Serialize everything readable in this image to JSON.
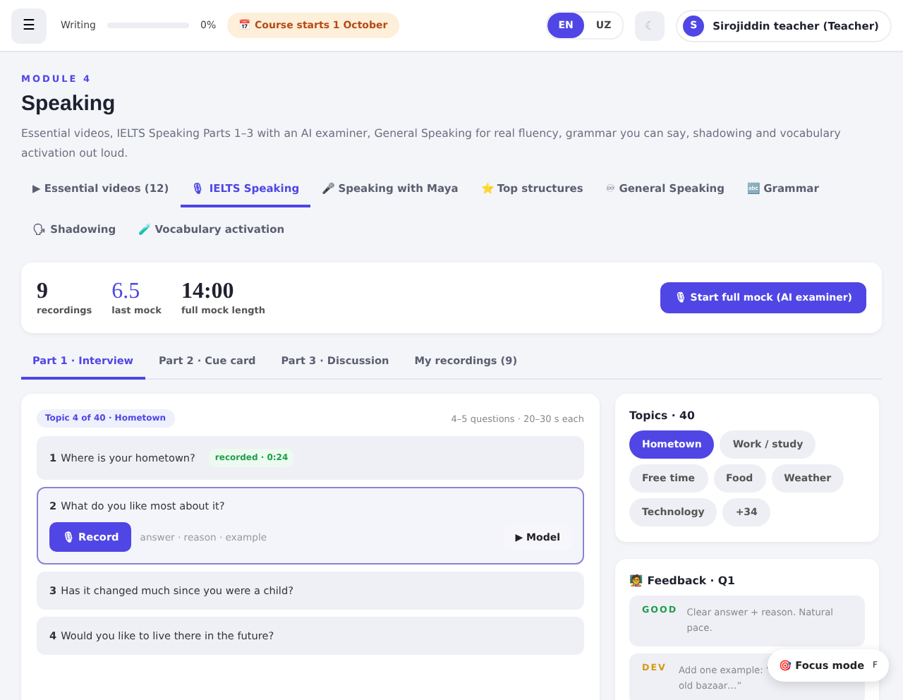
{
  "topbar": {
    "menu_icon": "☰",
    "progress": {
      "label": "Writing",
      "level": 0,
      "reading": "0%"
    },
    "notice": "📅 Course starts 1 October",
    "languages": [
      {
        "label": "EN",
        "selected": true
      },
      {
        "label": "UZ",
        "selected": false
      }
    ],
    "theme_icon": "☾",
    "user": {
      "initial": "S",
      "name": "Sirojiddin teacher (Teacher)"
    }
  },
  "module": {
    "eyebrow": "MODULE 4",
    "title": "Speaking",
    "description": "Essential videos, IELTS Speaking Parts 1–3 with an AI examiner, General Speaking for real fluency, grammar you can say, shadowing and vocabulary activation out loud."
  },
  "tabs": [
    {
      "label": "▶ Essential videos (12)",
      "selected": false
    },
    {
      "label": "🎙 IELTS Speaking",
      "selected": true
    },
    {
      "label": "🎤 Speaking with Maya",
      "selected": false
    },
    {
      "label": "⭐ Top structures",
      "selected": false
    },
    {
      "label": "♾ General Speaking",
      "selected": false
    },
    {
      "label": "🔤 Grammar",
      "selected": false
    },
    {
      "label": "🗣 Shadowing",
      "selected": false
    },
    {
      "label": "🧪 Vocabulary activation",
      "selected": false
    }
  ],
  "stats": [
    {
      "value": "9",
      "label": "recordings",
      "highlight": false
    },
    {
      "value": "6.5",
      "label": "last mock",
      "highlight": true
    },
    {
      "value": "14:00",
      "label": "full mock length",
      "highlight": false
    }
  ],
  "start_button": "🎙 Start full mock (AI examiner)",
  "part_tabs": [
    {
      "label": "Part 1 · Interview",
      "selected": true
    },
    {
      "label": "Part 2 · Cue card",
      "selected": false
    },
    {
      "label": "Part 3 · Discussion",
      "selected": false
    },
    {
      "label": "My recordings (9)",
      "selected": false
    }
  ],
  "practice": {
    "topic_chip": "Topic 4 of 40 · Hometown",
    "meta": "4–5 questions · 20–30 s each",
    "questions": [
      {
        "number": "1",
        "text": "Where is your hometown?",
        "status": "recorded · 0:24",
        "selected": false
      },
      {
        "number": "2",
        "text": "What do you like most about it?",
        "selected": true,
        "record_button": "🎙 Record",
        "hint": "answer · reason · example",
        "model_button": "▶ Model"
      },
      {
        "number": "3",
        "text": "Has it changed much since you were a child?",
        "selected": false
      },
      {
        "number": "4",
        "text": "Would you like to live there in the future?",
        "selected": false
      }
    ]
  },
  "topics": {
    "title": "Topics · 40",
    "items": [
      {
        "label": "Hometown",
        "selected": true
      },
      {
        "label": "Work / study",
        "selected": false
      },
      {
        "label": "Free time",
        "selected": false
      },
      {
        "label": "Food",
        "selected": false
      },
      {
        "label": "Weather",
        "selected": false
      },
      {
        "label": "Technology",
        "selected": false
      },
      {
        "label": "+34",
        "selected": false
      }
    ]
  },
  "feedback": {
    "title": "🧑‍🏫 Feedback · Q1",
    "items": [
      {
        "kind": "good",
        "tag": "GOOD",
        "text": "Clear answer + reason. Natural pace."
      },
      {
        "kind": "dev",
        "tag": "DEV",
        "text": "Add one example: “",
        "text_line_2": "old bazaar…”"
      }
    ]
  },
  "focus_pill": {
    "label": "🎯 Focus mode",
    "key": "F"
  }
}
